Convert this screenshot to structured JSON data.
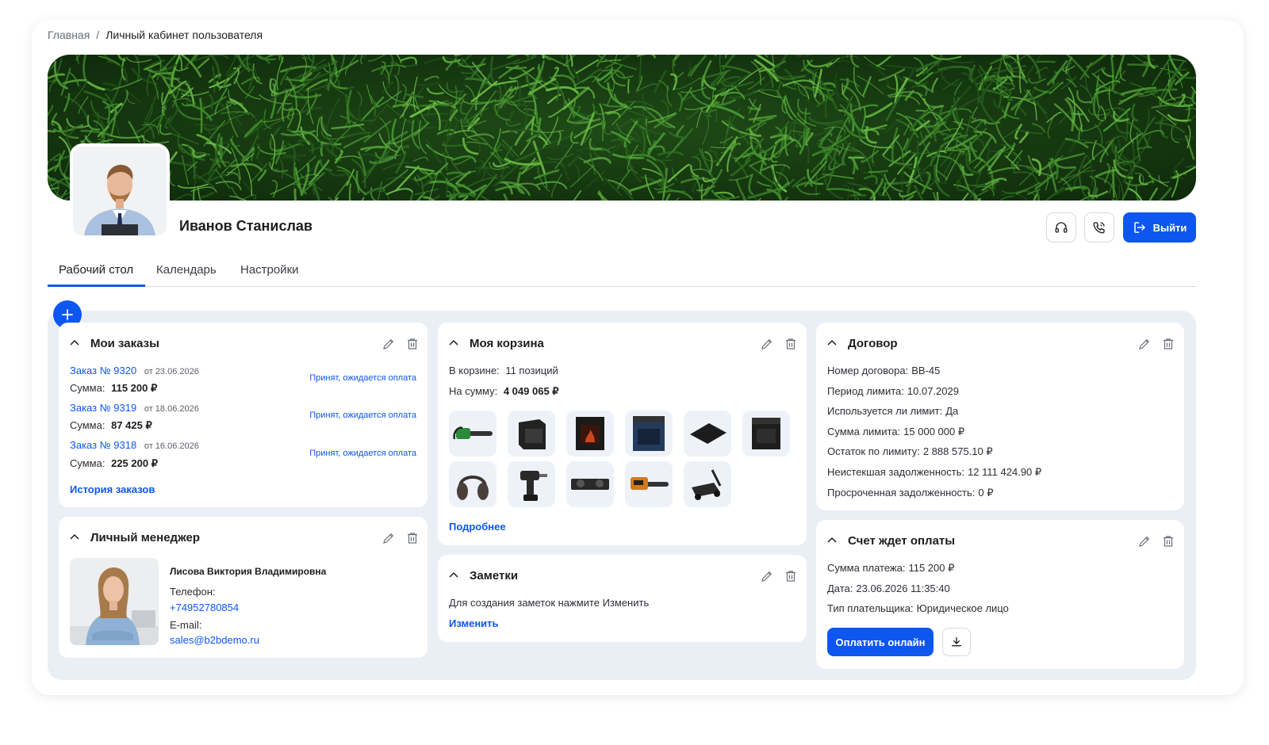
{
  "breadcrumb": {
    "home": "Главная",
    "separator": "/",
    "current": "Личный кабинет пользователя"
  },
  "user": {
    "name": "Иванов Станислав"
  },
  "header": {
    "logout_label": "Выйти"
  },
  "tabs": [
    {
      "label": "Рабочий стол",
      "active": true
    },
    {
      "label": "Календарь",
      "active": false
    },
    {
      "label": "Настройки",
      "active": false
    }
  ],
  "orders": {
    "title": "Мои заказы",
    "sum_label": "Сумма:",
    "items": [
      {
        "number": "Заказ № 9320",
        "date": "от 23.06.2026",
        "sum": "115 200 ₽",
        "status": "Принят, ожидается оплата"
      },
      {
        "number": "Заказ № 9319",
        "date": "от 18.06.2026",
        "sum": "87 425 ₽",
        "status": "Принят, ожидается оплата"
      },
      {
        "number": "Заказ № 9318",
        "date": "от 16.06.2026",
        "sum": "225 200 ₽",
        "status": "Принят, ожидается оплата"
      }
    ],
    "history_link": "История заказов"
  },
  "manager": {
    "title": "Личный менеджер",
    "name": "Лисова Виктория Владимировна",
    "phone_label": "Телефон:",
    "phone": "+74952780854",
    "email_label": "E-mail:",
    "email": "sales@b2bdemo.ru"
  },
  "cart": {
    "title": "Моя корзина",
    "count_label": "В корзине:",
    "count": "11 позиций",
    "sum_label": "На сумму:",
    "sum": "4 049 065 ₽",
    "more_link": "Подробнее",
    "products": [
      "chainsaw",
      "oven",
      "fireplace",
      "stove",
      "induction-hob",
      "gas-stove",
      "headphones",
      "drill",
      "gas-hob",
      "chainsaw-orange",
      "lawn-mower"
    ]
  },
  "notes": {
    "title": "Заметки",
    "text": "Для создания заметок нажмите Изменить",
    "edit_link": "Изменить"
  },
  "contract": {
    "title": "Договор",
    "rows": [
      {
        "label": "Номер договора:",
        "value": "BB-45"
      },
      {
        "label": "Период лимита:",
        "value": "10.07.2029"
      },
      {
        "label": "Используется ли лимит:",
        "value": "Да"
      },
      {
        "label": "Сумма лимита:",
        "value": "15 000 000 ₽"
      },
      {
        "label": "Остаток по лимиту:",
        "value": "2 888 575.10 ₽"
      },
      {
        "label": "Неистекшая задолженность:",
        "value": "12 111 424.90 ₽"
      },
      {
        "label": "Просроченная задолженность:",
        "value": "0 ₽"
      }
    ]
  },
  "invoice": {
    "title": "Счет ждет оплаты",
    "rows": [
      {
        "label": "Сумма платежа:",
        "value": "115 200 ₽"
      },
      {
        "label": "Дата:",
        "value": "23.06.2026 11:35:40"
      },
      {
        "label": "Тип плательщика:",
        "value": "Юридическое лицо"
      }
    ],
    "pay_label": "Оплатить онлайн"
  },
  "colors": {
    "accent": "#0d57f0",
    "dashboard_bg": "#eaeef5"
  }
}
